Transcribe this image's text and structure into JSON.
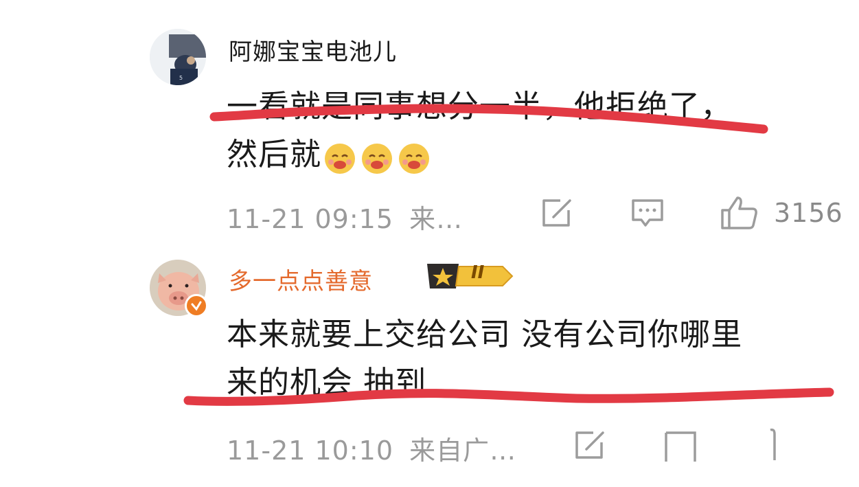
{
  "comments": [
    {
      "username": "阿娜宝宝电池儿",
      "username_color": "#1a1a1a",
      "text_lines": [
        "一看就是同事想分一半，他拒绝了，",
        "然后就"
      ],
      "emojis": [
        "yum-face-emoji",
        "yum-face-emoji",
        "yum-face-emoji"
      ],
      "time": "11-21 09:15",
      "source": "来…",
      "like_count": "3156"
    },
    {
      "username": "多一点点善意",
      "username_color": "#e46a2d",
      "level_badge": "II",
      "text_lines": [
        "本来就要上交给公司 没有公司你哪里",
        "来的机会 抽到"
      ],
      "time": "11-21 10:10",
      "source": "来自广…"
    }
  ],
  "colors": {
    "annotation_red": "#e23a44",
    "meta_gray": "#9a9a9a",
    "icon_gray": "#9c9c9c",
    "orange": "#ef7d24",
    "badge_dark": "#2e2b2a",
    "badge_gold": "#f2c13b"
  }
}
